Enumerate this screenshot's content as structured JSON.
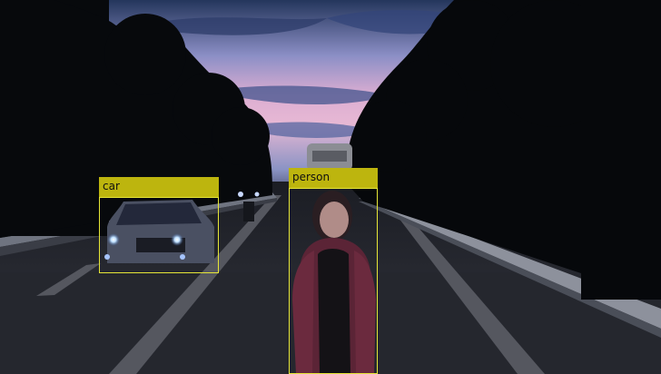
{
  "image": {
    "description_colors": {
      "sky_top": "#2b3d63",
      "sky_mid": "#7f8fc0",
      "sky_glow": "#e2b3cf",
      "tree": "#080a0d",
      "road": "#2a2c33"
    }
  },
  "detections": [
    {
      "label": "car",
      "color": "#bdb50e"
    },
    {
      "label": "person",
      "color": "#bdb50e"
    }
  ]
}
